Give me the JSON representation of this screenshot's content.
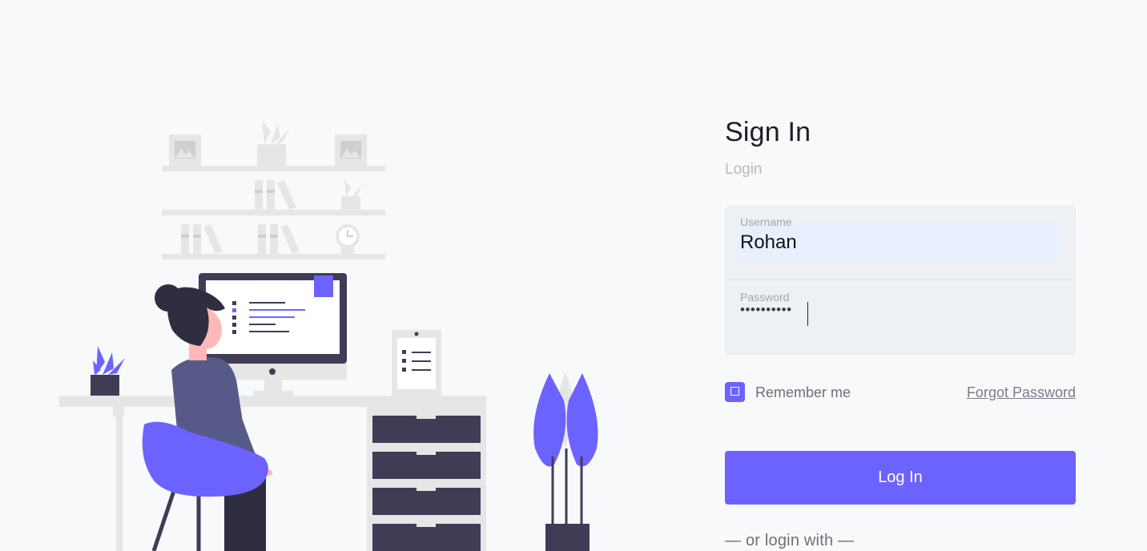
{
  "colors": {
    "accent": "#6c63ff",
    "background": "#f8f9fb",
    "field_panel": "#edf1f3",
    "username_autofill": "#e8f0fe"
  },
  "illustration": {
    "icon": "woman-at-computer-desk-illustration"
  },
  "form": {
    "title": "Sign In",
    "subtitle": "Login",
    "username": {
      "label": "Username",
      "value": "Rohan"
    },
    "password": {
      "label": "Password",
      "masked_value": "••••••••••"
    },
    "remember_me": {
      "label": "Remember me",
      "checked": false
    },
    "forgot_password": "Forgot Password",
    "login_button": "Log In",
    "alt_login": "— or login with —"
  }
}
